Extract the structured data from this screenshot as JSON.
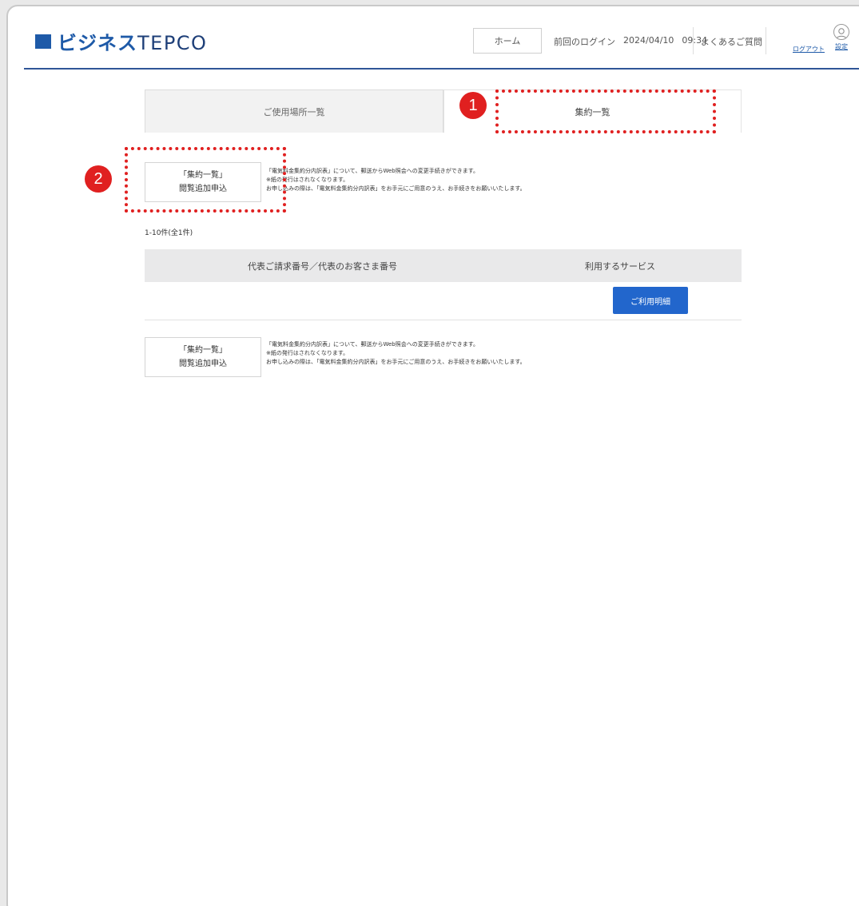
{
  "header": {
    "logo_text_ja": "ビジネス",
    "logo_text_latin": "TEPCO",
    "home_label": "ホーム",
    "last_login_label": "前回のログイン",
    "last_login_date": "2024/04/10",
    "last_login_time": "09:34",
    "faq_label": "よくあるご質問",
    "logout_label": "ログアウト",
    "settings_label": "設定",
    "brand_color": "#1e5aa8"
  },
  "tabs": [
    {
      "label": "ご使用場所一覧",
      "active": false
    },
    {
      "label": "集約一覧",
      "active": true
    }
  ],
  "info_blocks": [
    {
      "button_line1": "「集約一覧」",
      "button_line2": "閲覧追加申込",
      "notes": [
        "「電気料金集約分内訳表」について、郵送からWeb照会への変更手続きができます。",
        "※紙の発行はされなくなります。",
        "お申し込みの際は、「電気料金集約分内訳表」をお手元にご用意のうえ、お手続きをお願いいたします。"
      ]
    },
    {
      "button_line1": "「集約一覧」",
      "button_line2": "閲覧追加申込",
      "notes": [
        "「電気料金集約分内訳表」について、郵送からWeb照会への変更手続きができます。",
        "※紙の発行はされなくなります。",
        "お申し込みの際は、「電気料金集約分内訳表」をお手元にご用意のうえ、お手続きをお願いいたします。"
      ]
    }
  ],
  "result_count": "1-10件(全1件)",
  "table": {
    "headers": [
      "代表ご請求番号／代表のお客さま番号",
      "利用するサービス"
    ],
    "rows": [
      {
        "number": "",
        "button_label": "ご利用明細"
      }
    ]
  },
  "annotations": [
    {
      "label": "1",
      "color": "#e02020"
    },
    {
      "label": "2",
      "color": "#e02020"
    }
  ]
}
